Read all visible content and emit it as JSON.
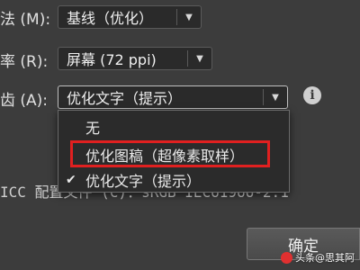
{
  "rows": {
    "method": {
      "label": "法 (M):",
      "value": "基线（优化）"
    },
    "resolution": {
      "label": "率 (R):",
      "value": "屏幕 (72 ppi)"
    },
    "antialias": {
      "label": "齿 (A):",
      "value": "优化文字（提示）"
    }
  },
  "dropdown": {
    "options": [
      {
        "label": "无",
        "checked": false
      },
      {
        "label": "优化图稿（超像素取样）",
        "checked": false
      },
      {
        "label": "优化文字（提示）",
        "checked": true
      }
    ],
    "check_glyph": "✔"
  },
  "info_icon": {
    "glyph": "i"
  },
  "icc_row": {
    "label": "ICC 配置文件 (C)：sRGB IEC61966-2.1"
  },
  "ok_button": {
    "label": "确定"
  },
  "watermark": {
    "text": "头条@思其阿"
  },
  "colors": {
    "highlight": "#e02020",
    "background": "#3c3c3c"
  }
}
